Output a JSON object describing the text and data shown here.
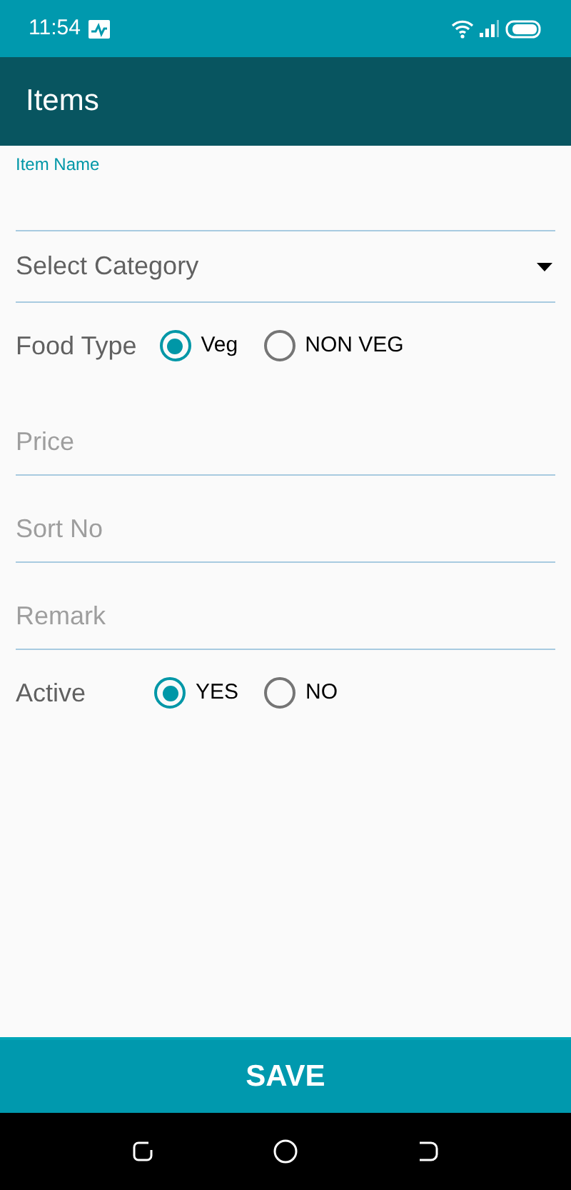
{
  "status_bar": {
    "time": "11:54"
  },
  "app_bar": {
    "title": "Items"
  },
  "item_name": {
    "label": "Item Name"
  },
  "category": {
    "placeholder": "Select Category"
  },
  "food_type": {
    "label": "Food Type",
    "options": [
      {
        "label": "Veg",
        "selected": true
      },
      {
        "label": "NON VEG",
        "selected": false
      }
    ]
  },
  "fields": [
    {
      "placeholder": "Price"
    },
    {
      "placeholder": "Sort No"
    },
    {
      "placeholder": "Remark"
    }
  ],
  "active": {
    "label": "Active",
    "options": [
      {
        "label": "YES",
        "selected": true
      },
      {
        "label": "NO",
        "selected": false
      }
    ]
  },
  "save_button": "SAVE"
}
